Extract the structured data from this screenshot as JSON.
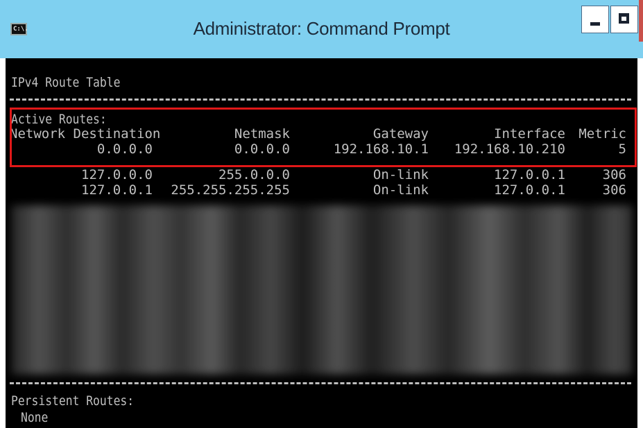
{
  "window": {
    "title": "Administrator: Command Prompt",
    "icon_text": "C:\\."
  },
  "console": {
    "heading": "IPv4 Route Table",
    "active_routes_label": "Active Routes:",
    "columns": [
      "Network Destination",
      "Netmask",
      "Gateway",
      "Interface",
      "Metric"
    ],
    "rows": [
      {
        "dest": "0.0.0.0",
        "mask": "0.0.0.0",
        "gateway": "192.168.10.1",
        "iface": "192.168.10.210",
        "metric": "5"
      },
      {
        "dest": "127.0.0.0",
        "mask": "255.0.0.0",
        "gateway": "On-link",
        "iface": "127.0.0.1",
        "metric": "306"
      },
      {
        "dest": "127.0.0.1",
        "mask": "255.255.255.255",
        "gateway": "On-link",
        "iface": "127.0.0.1",
        "metric": "306"
      }
    ],
    "persistent_routes_label": "Persistent Routes:",
    "persistent_value": "None"
  },
  "colors": {
    "titlebar": "#7fd0f0",
    "console_bg": "#000000",
    "console_text": "#c0c0c0",
    "highlight": "#e01818"
  },
  "icons": [
    "cmd-app-icon",
    "minimize-icon",
    "maximize-icon"
  ]
}
